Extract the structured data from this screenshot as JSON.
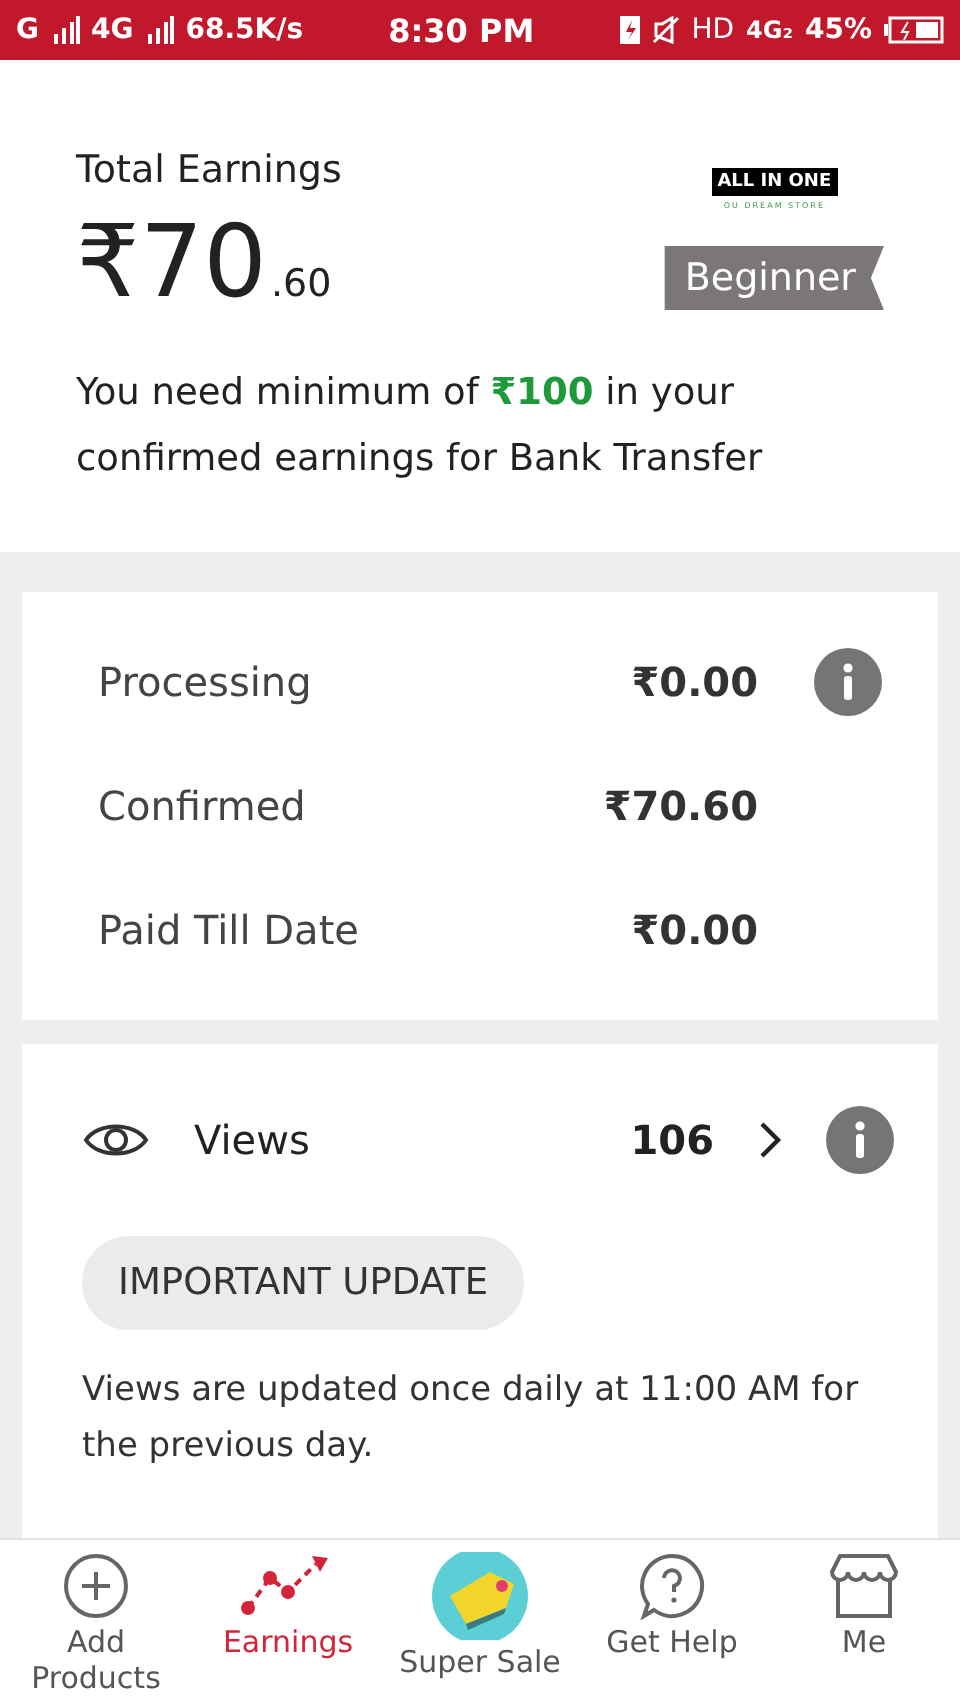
{
  "status_bar": {
    "network_1": "G",
    "network_2": "4G",
    "speed": "68.5K/s",
    "time": "8:30 PM",
    "hd": "HD",
    "data": "4G₂",
    "battery": "45%"
  },
  "earnings": {
    "label": "Total Earnings",
    "currency": "₹",
    "amount": "70",
    "decimals": ".60",
    "logo_title": "ALL IN ONE",
    "logo_subtitle": "OU DREAM STORE",
    "badge": "Beginner",
    "note": "You need minimum of **₹100** in your confirmed earnings for Bank Transfer"
  },
  "summary": [
    {
      "label": "Processing",
      "value": "₹0.00",
      "info": true
    },
    {
      "label": "Confirmed",
      "value": "₹70.60",
      "info": false
    },
    {
      "label": "Paid Till Date",
      "value": "₹0.00",
      "info": false
    }
  ],
  "views": {
    "label": "Views",
    "count": "106",
    "button": "IMPORTANT UPDATE",
    "note": "Views are updated once daily at 11:00 AM for the previous day."
  },
  "nav": [
    {
      "kind": "add",
      "label": "Add Products",
      "selected": false
    },
    {
      "kind": "earnings",
      "label": "Earnings",
      "selected": true
    },
    {
      "kind": "sale",
      "label": "Super Sale",
      "selected": false
    },
    {
      "kind": "help",
      "label": "Get Help",
      "selected": false
    },
    {
      "kind": "me",
      "label": "Me",
      "selected": false
    }
  ]
}
